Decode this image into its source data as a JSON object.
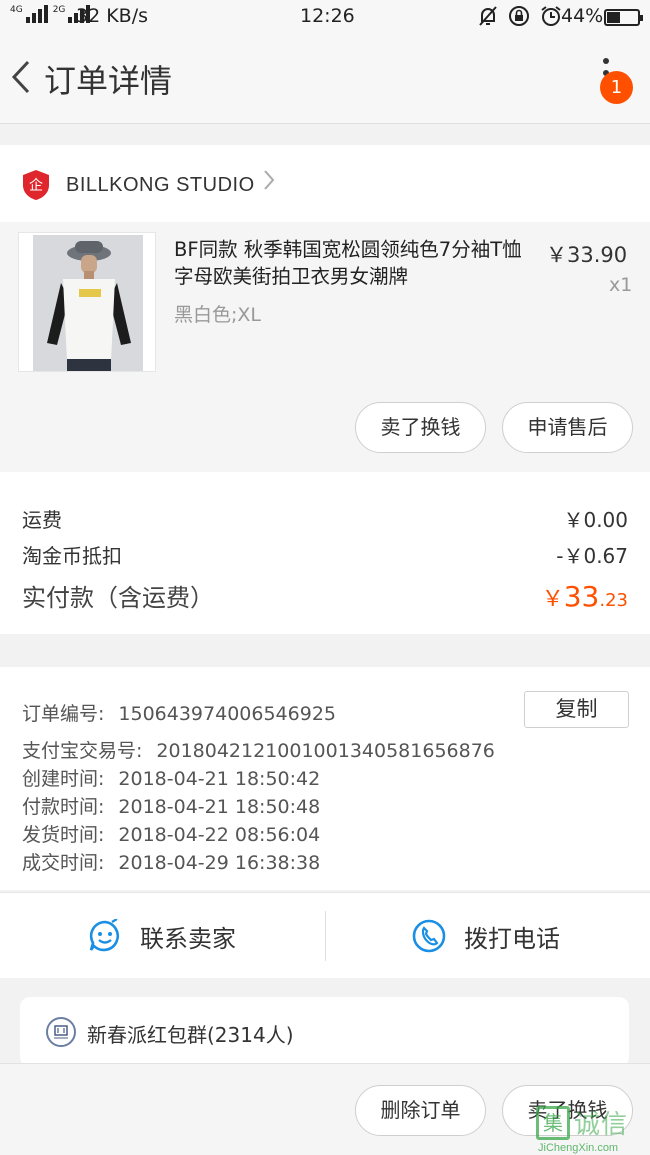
{
  "status_bar": {
    "network": "4G",
    "network2": "2G",
    "speed": "32 KB/s",
    "time": "12:26",
    "battery_pct": "44%",
    "battery_level": 0.44
  },
  "nav": {
    "title": "订单详情",
    "badge_count": "1"
  },
  "shop": {
    "logo_text": "企",
    "name": "BILLKONG STUDIO"
  },
  "item": {
    "title": "BF同款 秋季韩国宽松圆领纯色7分袖T恤字母欧美街拍卫衣男女潮牌",
    "price": "￥33.90",
    "qty": "x1",
    "sku": "黑白色;XL",
    "btn_sell": "卖了换钱",
    "btn_after_sale": "申请售后"
  },
  "fees": {
    "shipping_label": "运费",
    "shipping_value": "￥0.00",
    "coin_label": "淘金币抵扣",
    "coin_value": "-￥0.67",
    "total_label": "实付款（含运费）",
    "total_currency": "￥",
    "total_int": "33",
    "total_dec": ".23"
  },
  "order_info": {
    "order_no_label": "订单编号:",
    "order_no": "150643974006546925",
    "copy_label": "复制",
    "alipay_label": "支付宝交易号:",
    "alipay_no": "2018042121001001340581656876",
    "created_label": "创建时间:",
    "created": "2018-04-21 18:50:42",
    "paid_label": "付款时间:",
    "paid": "2018-04-21 18:50:48",
    "shipped_label": "发货时间:",
    "shipped": "2018-04-22 08:56:04",
    "completed_label": "成交时间:",
    "completed": "2018-04-29 16:38:38"
  },
  "contact": {
    "seller_label": "联系卖家",
    "call_label": "拨打电话"
  },
  "group": {
    "name": "新春派红包群(2314人)"
  },
  "bottom": {
    "delete_label": "删除订单",
    "sell_label": "卖了换钱"
  },
  "watermark": {
    "logo_char": "集",
    "cn": "诚信",
    "en": "JiChengXin.com"
  },
  "colors": {
    "accent": "#ff5000",
    "contact_icon": "#1a8fe3",
    "shop_logo": "#e0262d"
  }
}
